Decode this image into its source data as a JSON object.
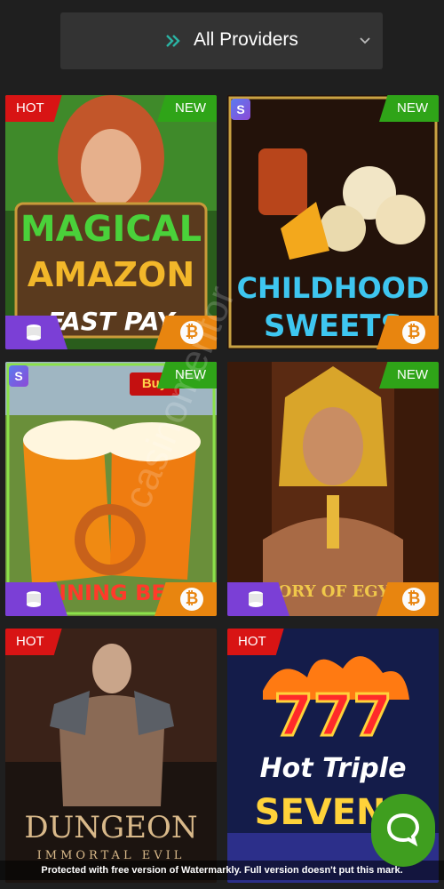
{
  "provider_filter": {
    "label": "All Providers"
  },
  "games": [
    {
      "title_line1": "MAGICAL",
      "title_line2": "AMAZON",
      "subtitle": "FAST PAY",
      "badge_left": "HOT",
      "badge_right": "NEW"
    },
    {
      "title_line1": "CHILDHOOD",
      "title_line2": "SWEETS",
      "badge_right": "NEW"
    },
    {
      "title_line1": "SPINNING BEERS",
      "corner_text": "Buy",
      "badge_right": "NEW"
    },
    {
      "title_line1": "GLORY OF EGYPT",
      "badge_right": "NEW"
    },
    {
      "title_line1": "DUNGEON",
      "title_line2": "IMMORTAL EVIL",
      "badge_left": "HOT"
    },
    {
      "title_line1": "Hot Triple",
      "title_line2": "SEVENS",
      "badge_left": "HOT"
    }
  ],
  "watermark_notice": "Protected with free version of Watermarkly. Full version doesn't put this mark.",
  "diagonal_watermark": "casinomentor",
  "colors": {
    "background": "#1f1f1f",
    "hot_badge": "#d81414",
    "new_badge": "#2fa418",
    "coins_corner": "#7b3fd6",
    "btc_corner": "#e8850f",
    "chat_button": "#3f9e1f",
    "provider_accent": "#2bb3a3"
  }
}
